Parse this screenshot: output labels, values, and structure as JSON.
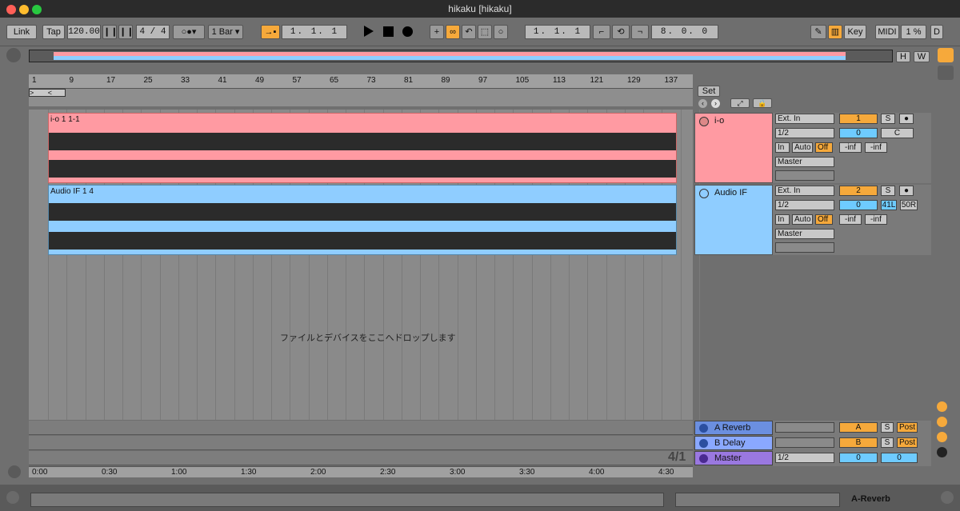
{
  "window": {
    "title": "hikaku  [hikaku]"
  },
  "transport": {
    "link": "Link",
    "tap": "Tap",
    "tempo": "120.00",
    "signature": "4 / 4",
    "quantize": "1 Bar",
    "arrangement_position": "1.  1.  1",
    "loop_start": "1.  1.  1",
    "loop_length": "8.  0.  0",
    "key": "Key",
    "midi": "MIDI",
    "cpu": "1 %",
    "disk": "D"
  },
  "overview": {
    "h": "H",
    "w": "W"
  },
  "ruler": {
    "bars": [
      "1",
      "9",
      "17",
      "25",
      "33",
      "41",
      "49",
      "57",
      "65",
      "73",
      "81",
      "89",
      "97",
      "105",
      "113",
      "121",
      "129",
      "137"
    ]
  },
  "set_button": "Set",
  "tracks": [
    {
      "clip_name": "i-o 1 1-1",
      "track_name": "i-o",
      "input_type": "Ext. In",
      "input_channel": "1/2",
      "monitor": [
        "In",
        "Auto",
        "Off"
      ],
      "output": "Master",
      "number": "1",
      "solo": "S",
      "volume": "0",
      "pan": "C",
      "peak_left": "-inf",
      "peak_right": "-inf",
      "color": "#ff9aa2"
    },
    {
      "clip_name": "Audio IF 1 4",
      "track_name": "Audio IF",
      "input_type": "Ext. In",
      "input_channel": "1/2",
      "monitor": [
        "In",
        "Auto",
        "Off"
      ],
      "output": "Master",
      "number": "2",
      "solo": "S",
      "volume": "0",
      "pan_left": "41L",
      "pan_right": "50R",
      "peak_left": "-inf",
      "peak_right": "-inf",
      "color": "#8fcdff"
    }
  ],
  "drop_hint": "ファイルとデバイスをここへドロップします",
  "returns": [
    {
      "name": "A Reverb",
      "letter": "A",
      "solo": "S",
      "post": "Post"
    },
    {
      "name": "B Delay",
      "letter": "B",
      "solo": "S",
      "post": "Post"
    }
  ],
  "master": {
    "name": "Master",
    "output": "1/2",
    "volume_left": "0",
    "volume_right": "0"
  },
  "grid_ratio": "4/1",
  "time_ruler": [
    "0:00",
    "0:30",
    "1:00",
    "1:30",
    "2:00",
    "2:30",
    "3:00",
    "3:30",
    "4:00",
    "4:30"
  ],
  "status": {
    "device": "A-Reverb"
  }
}
